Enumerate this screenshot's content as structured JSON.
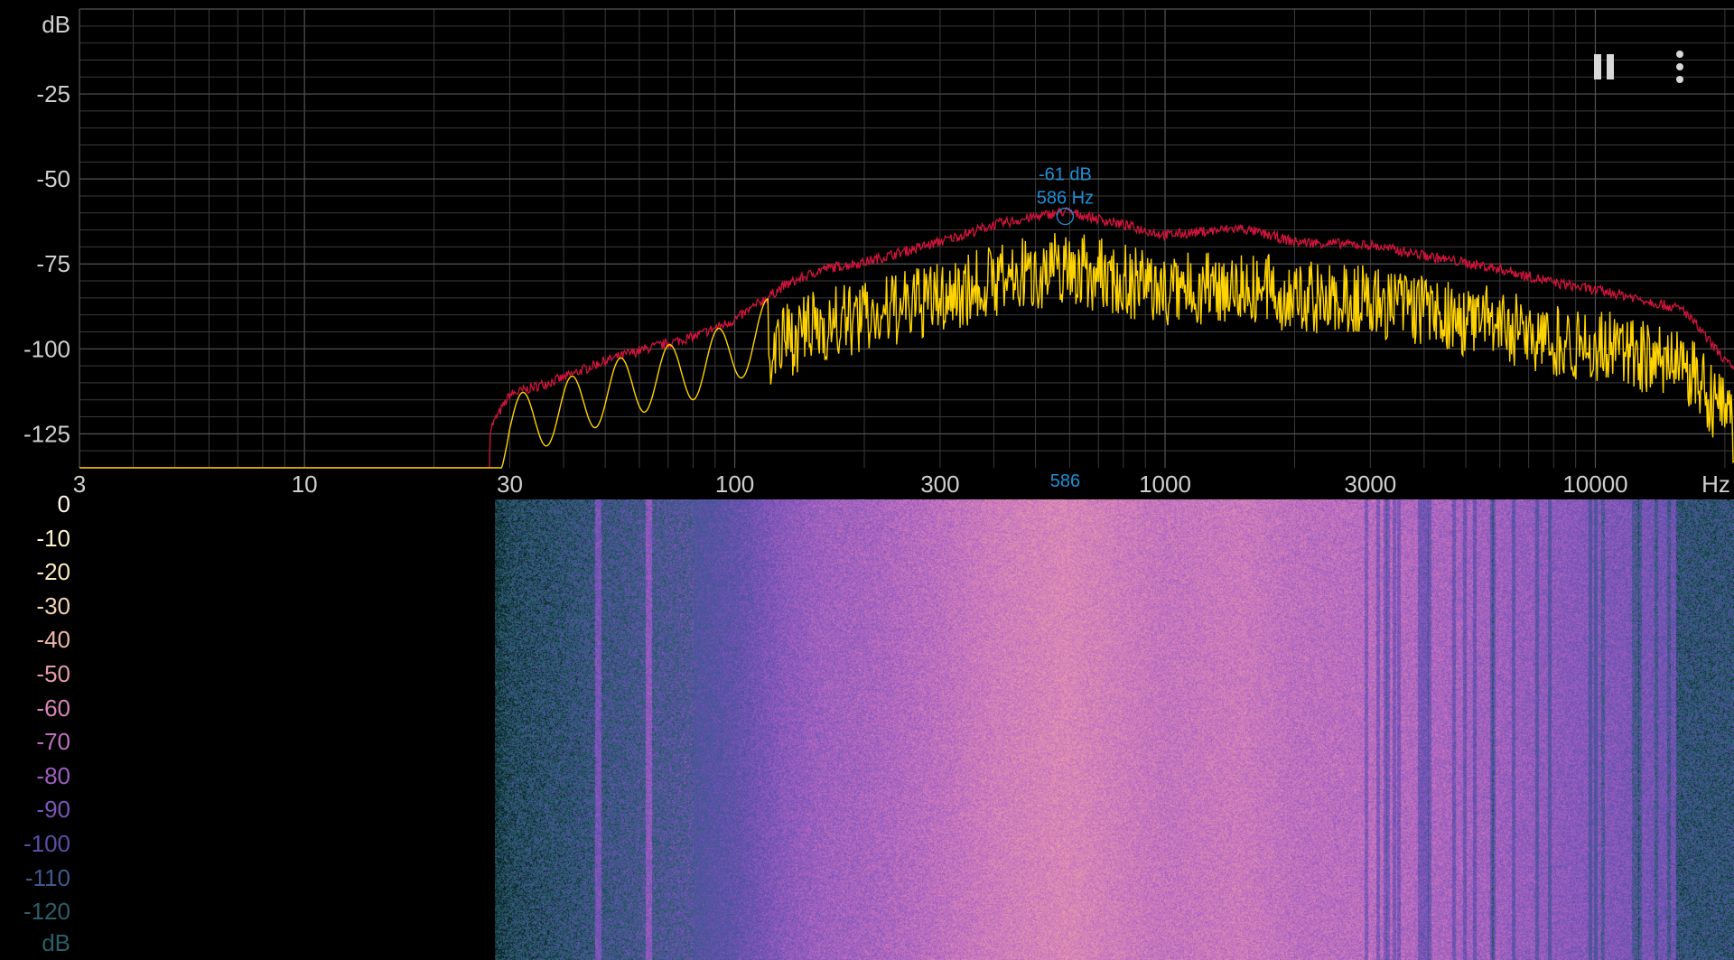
{
  "spectrum": {
    "y_unit": "dB",
    "x_unit": "Hz",
    "y_ticks": [
      "-25",
      "-50",
      "-75",
      "-100",
      "-125"
    ],
    "x_ticks": [
      "3",
      "10",
      "30",
      "100",
      "300",
      "1000",
      "3000",
      "10000"
    ],
    "peak": {
      "db_label": "-61 dB",
      "hz_label": "586 Hz",
      "axis_label": "586",
      "freq_hz": 586,
      "level_db": -61
    },
    "colors": {
      "live_trace": "#ffd400",
      "peak_hold_trace": "#d0143c",
      "peak_marker": "#1e90d6",
      "grid": "#3a3a3a",
      "grid_major": "#555555"
    }
  },
  "spectrogram": {
    "unit": "dB",
    "scale_labels": [
      "0",
      "-10",
      "-20",
      "-30",
      "-40",
      "-50",
      "-60",
      "-70",
      "-80",
      "-90",
      "-100",
      "-110",
      "-120"
    ],
    "scale_colors": [
      "#fffbe6",
      "#fff5cc",
      "#fde9c0",
      "#f6d3b2",
      "#f0b8a6",
      "#e89cab",
      "#d985b8",
      "#c070c0",
      "#9d5ec0",
      "#7a56b8",
      "#5a4ea8",
      "#3f5a8e",
      "#2a5f6a"
    ]
  },
  "controls": {
    "pause_icon": "pause-icon",
    "menu_icon": "more-vert-icon"
  }
}
